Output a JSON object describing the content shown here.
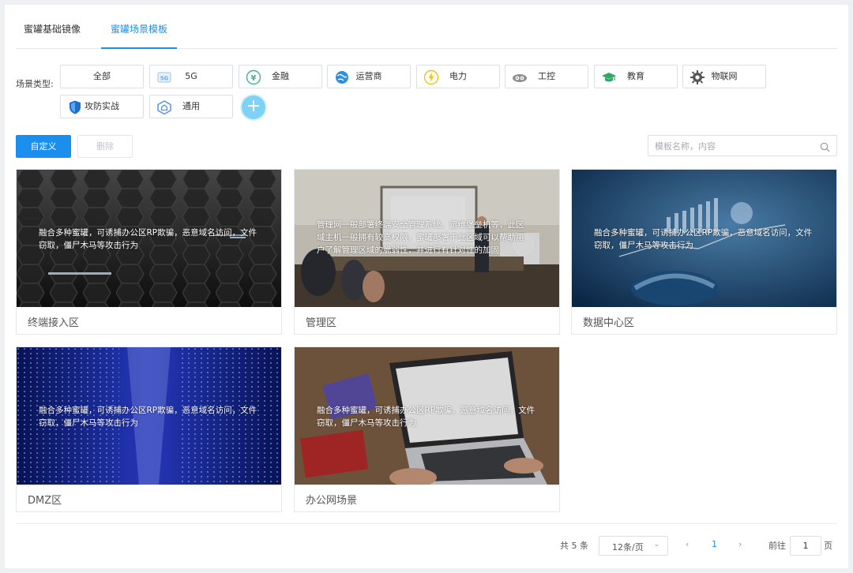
{
  "tabs": [
    {
      "label": "蜜罐基础镜像",
      "active": false
    },
    {
      "label": "蜜罐场景模板",
      "active": true
    }
  ],
  "scene_types": {
    "label": "场景类型:",
    "items": [
      {
        "label": "全部",
        "icon": ""
      },
      {
        "label": "5G",
        "icon": "5g-icon"
      },
      {
        "label": "金融",
        "icon": "yen-icon"
      },
      {
        "label": "运营商",
        "icon": "globe-icon"
      },
      {
        "label": "电力",
        "icon": "lightning-icon"
      },
      {
        "label": "工控",
        "icon": "gears-icon"
      },
      {
        "label": "教育",
        "icon": "graduation-cap-icon"
      },
      {
        "label": "物联网",
        "icon": "gear-icon"
      },
      {
        "label": "攻防实战",
        "icon": "shield-icon"
      },
      {
        "label": "通用",
        "icon": "house-icon"
      }
    ],
    "add_label": "+"
  },
  "toolbar": {
    "custom_label": "自定义",
    "delete_label": "删除",
    "search_placeholder": "模板名称，内容"
  },
  "cards": [
    {
      "title": "终端接入区",
      "desc": "融合多种蜜罐，可诱捕办公区RP欺骗，恶意域名访问，文件窃取，僵尸木马等攻击行为"
    },
    {
      "title": "管理区",
      "desc": "管理网一般部署终端安全管理系统、运维堡垒机等，此区域主机一般拥有较高权限，蜜罐部署于此区域可以帮助用户了解管理区域的脆弱性，并进行有针对性的加固"
    },
    {
      "title": "数据中心区",
      "desc": "融合多种蜜罐，可诱捕办公区RP欺骗，恶意域名访问，文件窃取，僵尸木马等攻击行为"
    },
    {
      "title": "DMZ区",
      "desc": "融合多种蜜罐，可诱捕办公区RP欺骗，恶意域名访问，文件窃取，僵尸木马等攻击行为"
    },
    {
      "title": "办公网场景",
      "desc": "融合多种蜜罐，可诱捕办公区RP欺骗，恶意域名访问，文件窃取，僵尸木马等攻击行为"
    }
  ],
  "pagination": {
    "total": "共 5 条",
    "page_size": "12条/页",
    "prev": "‹",
    "current": "1",
    "next": "›",
    "goto_label": "前往",
    "goto_value": "1",
    "page_suffix": "页"
  },
  "colors": {
    "accent": "#1b8fee",
    "add_button": "#7fd2f4"
  }
}
